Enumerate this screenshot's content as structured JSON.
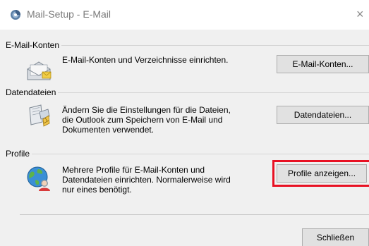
{
  "window": {
    "title": "Mail-Setup - E-Mail",
    "close_glyph": "×"
  },
  "groups": {
    "email_accounts": {
      "label": "E-Mail-Konten",
      "description": "E-Mail-Konten und Verzeichnisse einrichten.",
      "button_label": "E-Mail-Konten...",
      "icon": "envelope-icon"
    },
    "data_files": {
      "label": "Datendateien",
      "description": "Ändern Sie die Einstellungen für die Dateien,\ndie Outlook zum Speichern von E-Mail und\nDokumenten verwendet.",
      "button_label": "Datendateien...",
      "icon": "data-files-icon"
    },
    "profiles": {
      "label": "Profile",
      "description": "Mehrere Profile für E-Mail-Konten und\nDatendateien einrichten. Normalerweise wird\nnur eines benötigt.",
      "button_label": "Profile anzeigen...",
      "icon": "profile-globe-icon"
    }
  },
  "footer": {
    "close_label": "Schließen"
  },
  "colors": {
    "highlight": "#e81123",
    "dialog_bg": "#f0f0f0",
    "button_bg": "#e1e1e1"
  }
}
